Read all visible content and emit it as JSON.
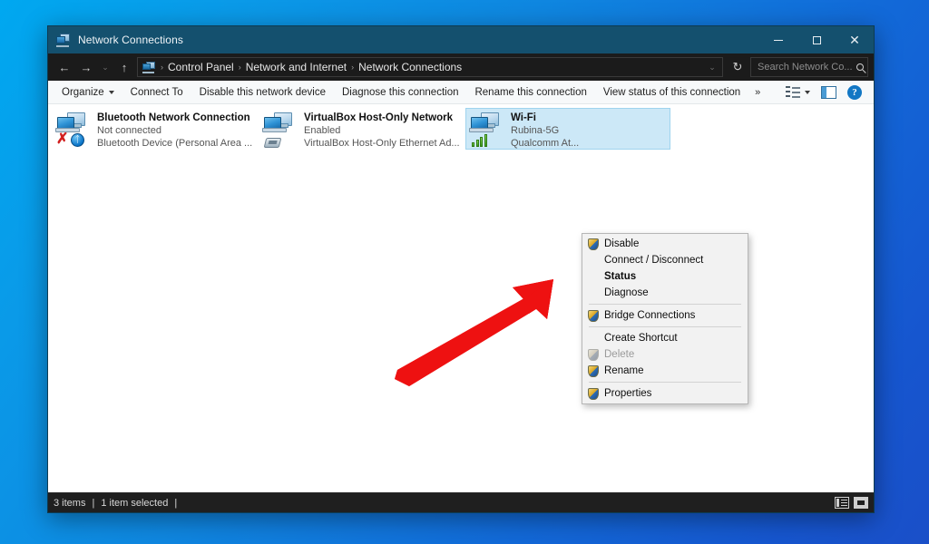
{
  "window": {
    "title": "Network Connections",
    "title_icon": "network-connections-icon",
    "controls": {
      "minimize": "─",
      "maximize": "□",
      "close": "✕"
    }
  },
  "address_bar": {
    "back": "←",
    "forward": "→",
    "recent": "⌄",
    "up": "↑",
    "breadcrumb": [
      "Control Panel",
      "Network and Internet",
      "Network Connections"
    ],
    "separator": "›",
    "history_dropdown": "⌄",
    "refresh": "↻",
    "search_placeholder": "Search Network Co..."
  },
  "command_bar": {
    "items": [
      {
        "label": "Organize",
        "has_caret": true
      },
      {
        "label": "Connect To",
        "has_caret": false
      },
      {
        "label": "Disable this network device",
        "has_caret": false
      },
      {
        "label": "Diagnose this connection",
        "has_caret": false
      },
      {
        "label": "Rename this connection",
        "has_caret": false
      },
      {
        "label": "View status of this connection",
        "has_caret": false
      }
    ],
    "overflow": "»",
    "view_button": "change-view-icon",
    "preview_button": "preview-pane-icon",
    "help_button": "?"
  },
  "connections": [
    {
      "name": "Bluetooth Network Connection",
      "status": "Not connected",
      "device": "Bluetooth Device (Personal Area ...",
      "icon": "network-adapter-icon",
      "badge": "bluetooth",
      "disconnected": true,
      "selected": false
    },
    {
      "name": "VirtualBox Host-Only Network",
      "status": "Enabled",
      "device": "VirtualBox Host-Only Ethernet Ad...",
      "icon": "network-adapter-icon",
      "badge": "ethernet",
      "disconnected": false,
      "selected": false
    },
    {
      "name": "Wi-Fi",
      "status": "Rubina-5G",
      "device": "Qualcomm At...",
      "icon": "network-adapter-icon",
      "badge": "wifi-signal",
      "disconnected": false,
      "selected": true
    }
  ],
  "context_menu": {
    "items": [
      {
        "label": "Disable",
        "shield": true,
        "bold": false,
        "disabled": false,
        "sep_after": false
      },
      {
        "label": "Connect / Disconnect",
        "shield": false,
        "bold": false,
        "disabled": false,
        "sep_after": false
      },
      {
        "label": "Status",
        "shield": false,
        "bold": true,
        "disabled": false,
        "sep_after": false
      },
      {
        "label": "Diagnose",
        "shield": false,
        "bold": false,
        "disabled": false,
        "sep_after": true
      },
      {
        "label": "Bridge Connections",
        "shield": true,
        "bold": false,
        "disabled": false,
        "sep_after": true
      },
      {
        "label": "Create Shortcut",
        "shield": false,
        "bold": false,
        "disabled": false,
        "sep_after": false
      },
      {
        "label": "Delete",
        "shield": true,
        "bold": false,
        "disabled": true,
        "sep_after": false
      },
      {
        "label": "Rename",
        "shield": true,
        "bold": false,
        "disabled": false,
        "sep_after": true
      },
      {
        "label": "Properties",
        "shield": true,
        "bold": false,
        "disabled": false,
        "sep_after": false
      }
    ]
  },
  "status_bar": {
    "item_count": "3 items",
    "sep1": "|",
    "selection": "1 item selected",
    "sep2": "|",
    "details_view": "details-view-icon",
    "tiles_view": "large-icons-view-icon"
  },
  "annotation": {
    "type": "arrow",
    "color": "#ee1111",
    "points_to": "Properties"
  },
  "colors": {
    "titlebar": "#14506e",
    "desktop_start": "#00a8f0",
    "desktop_end": "#1a4fc8",
    "selection": "#cce8f7",
    "accent": "#1277c4",
    "arrow": "#ee1111"
  }
}
